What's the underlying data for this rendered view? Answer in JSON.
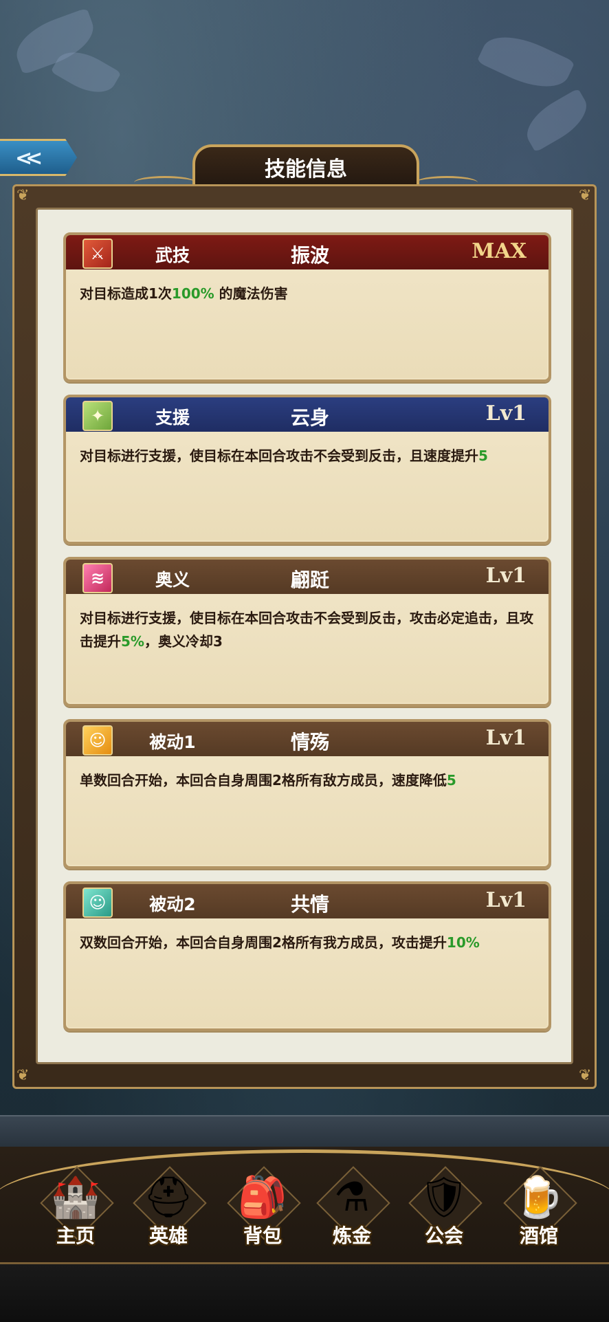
{
  "header": {
    "title": "技能信息"
  },
  "skills": [
    {
      "type": "武技",
      "name": "振波",
      "level": "MAX",
      "icon": "sword-icon",
      "header_color": "#7e1a14",
      "desc_parts": [
        "对目标造成1次",
        "100%",
        " 的魔法伤害"
      ]
    },
    {
      "type": "支援",
      "name": "云身",
      "level": "Lv1",
      "icon": "sparkle-support-icon",
      "header_color": "#2b3e80",
      "desc_parts": [
        "对目标进行支援，使目标在本回合攻击不会受到反击，且速度提升",
        "5",
        ""
      ]
    },
    {
      "type": "奥义",
      "name": "翩跹",
      "level": "Lv1",
      "icon": "claw-ultimate-icon",
      "header_color": "#6b4a30",
      "desc_parts": [
        "对目标进行支援，使目标在本回合攻击不会受到反击，攻击必定追击，且攻击提升",
        "5%",
        "，奥义冷却3"
      ]
    },
    {
      "type": "被动1",
      "name": "情殇",
      "level": "Lv1",
      "icon": "person-passive-icon",
      "header_color": "#6b4a30",
      "desc_parts": [
        "单数回合开始，本回合自身周围2格所有敌方成员，速度降低",
        "5",
        ""
      ]
    },
    {
      "type": "被动2",
      "name": "共情",
      "level": "Lv1",
      "icon": "person-passive-icon",
      "header_color": "#6b4a30",
      "desc_parts": [
        "双数回合开始，本回合自身周围2格所有我方成员，攻击提升",
        "10%",
        ""
      ]
    }
  ],
  "nav": [
    {
      "label": "主页",
      "icon": "castle-icon"
    },
    {
      "label": "英雄",
      "icon": "knight-helmet-icon"
    },
    {
      "label": "背包",
      "icon": "backpack-icon"
    },
    {
      "label": "炼金",
      "icon": "potion-icon"
    },
    {
      "label": "公会",
      "icon": "guild-shield-icon"
    },
    {
      "label": "酒馆",
      "icon": "tavern-beer-icon"
    }
  ],
  "colors": {
    "highlight_green": "#2a9a2a",
    "gold_trim": "#c9a45c",
    "max_gold": "#f2d58a"
  }
}
